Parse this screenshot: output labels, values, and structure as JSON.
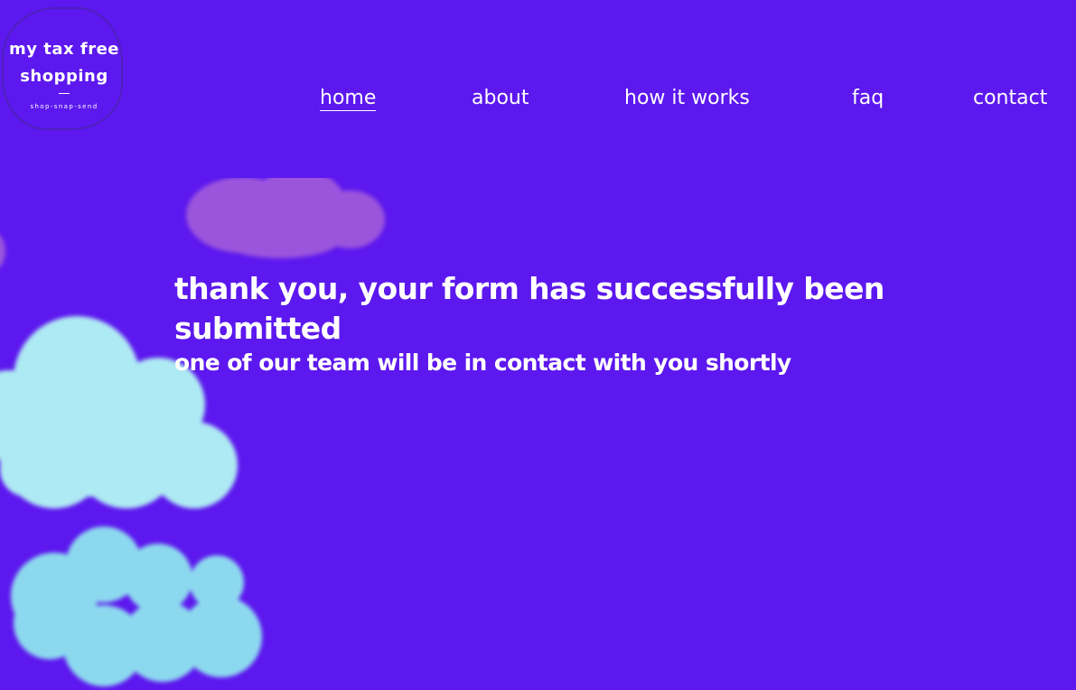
{
  "colors": {
    "background": "#5c18ee",
    "text": "#ffffff",
    "cloud_purple": "#9b55dc",
    "cloud_light_cyan": "#aeeaf3",
    "cloud_cyan": "#8cd9ef"
  },
  "logo": {
    "line1": "my tax free",
    "line2": "shopping",
    "tagline": "shop-snap-send"
  },
  "nav": {
    "items": [
      {
        "label": "home",
        "active": true
      },
      {
        "label": "about",
        "active": false
      },
      {
        "label": "how it works",
        "active": false
      },
      {
        "label": "faq",
        "active": false
      },
      {
        "label": "contact",
        "active": false
      }
    ]
  },
  "main": {
    "title": "thank you, your form has successfully been submitted",
    "subtitle": "one of our team will be in contact with you shortly"
  }
}
